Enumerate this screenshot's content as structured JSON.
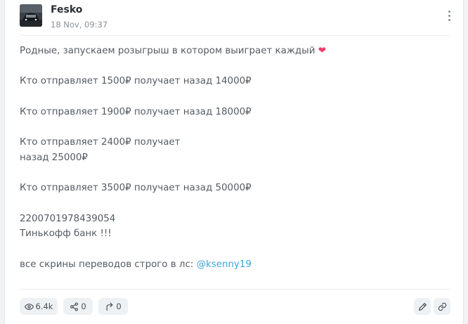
{
  "post": {
    "author": "Fesko",
    "date": "18 Nov, 09:37",
    "lines": [
      "Родные, запускаем розыгрыш в котором выиграет каждый",
      "",
      "Кто отправляет 1500₽ получает назад 14000₽",
      "",
      "Кто отправляет 1900₽ получает назад 18000₽",
      "",
      "Кто отправляет 2400₽ получает",
      "назад 25000₽",
      "",
      "Кто отправляет 3500₽ получает назад 50000₽",
      "",
      "2200701978439054",
      "Тинькофф банк !!!",
      "",
      "все скрины переводов строго в лс:"
    ],
    "heart_emoji": "❤",
    "mention": "@ksenny19"
  },
  "footer": {
    "views": "6.4k",
    "shares": "0",
    "reposts": "0"
  },
  "icons": {
    "menu": "kebab-icon",
    "views": "eye-icon",
    "shares": "share-icon",
    "reposts": "repost-arrow-icon",
    "edit": "pencil-icon",
    "link": "link-icon"
  },
  "colors": {
    "mention": "#3aa3dc",
    "heart": "#ec3b6a",
    "text": "#555b62",
    "button_bg": "#eef1f4"
  }
}
